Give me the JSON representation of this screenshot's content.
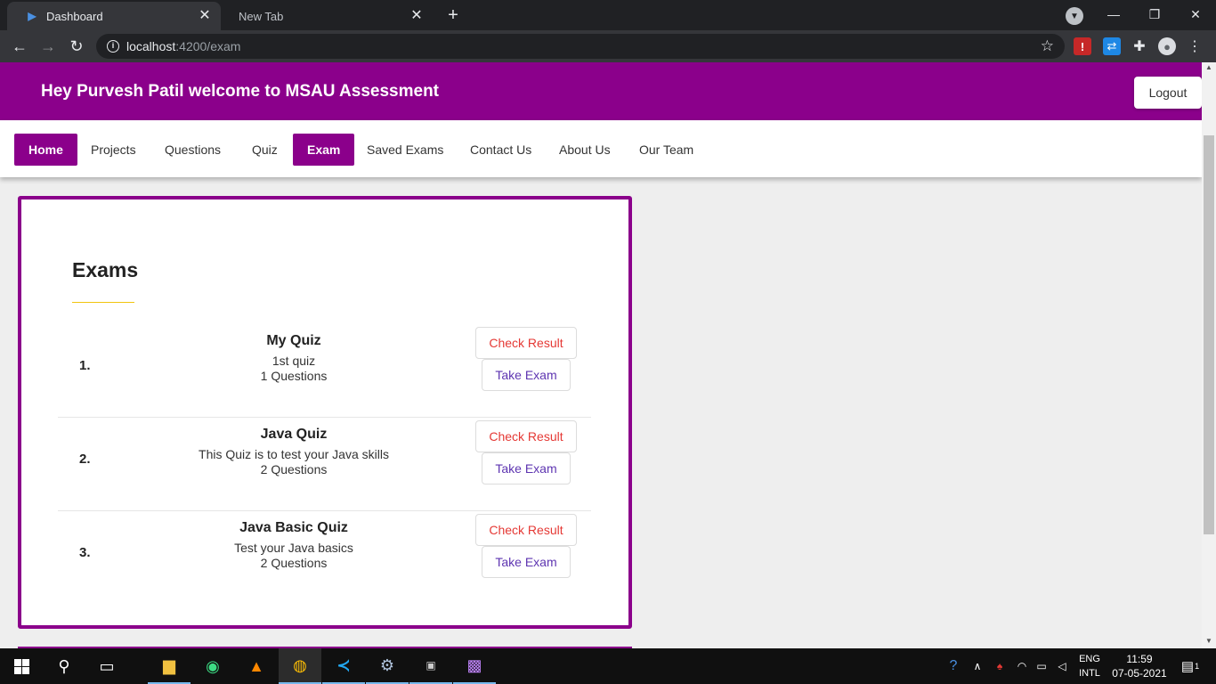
{
  "browser": {
    "tabs": [
      {
        "title": "Dashboard",
        "active": true
      },
      {
        "title": "New Tab",
        "active": false
      }
    ],
    "url_host": "localhost",
    "url_path": ":4200/exam",
    "close_glyph": "✕",
    "new_tab_glyph": "+",
    "icons": {
      "back": "←",
      "forward": "→",
      "reload": "↻",
      "star": "☆",
      "minimize": "—",
      "restore": "❐",
      "close": "✕"
    }
  },
  "app": {
    "brand_color": "#8b008b",
    "welcome": "Hey Purvesh Patil welcome to MSAU Assessment",
    "logout_label": "Logout",
    "nav": [
      {
        "label": "Home",
        "active": true
      },
      {
        "label": "Projects",
        "active": false
      },
      {
        "label": "Questions",
        "active": false
      },
      {
        "label": "Quiz",
        "active": false
      },
      {
        "label": "Exam",
        "active": true
      },
      {
        "label": "Saved Exams",
        "active": false
      },
      {
        "label": "Contact Us",
        "active": false
      },
      {
        "label": "About Us",
        "active": false
      },
      {
        "label": "Our Team",
        "active": false
      }
    ],
    "section_title": "Exams",
    "exams": [
      {
        "num": "1.",
        "name": "My Quiz",
        "desc": "1st quiz",
        "questions": "1 Questions",
        "check": "Check Result",
        "take": "Take Exam"
      },
      {
        "num": "2.",
        "name": "Java Quiz",
        "desc": "This Quiz is to test your Java skills",
        "questions": "2 Questions",
        "check": "Check Result",
        "take": "Take Exam"
      },
      {
        "num": "3.",
        "name": "Java Basic Quiz",
        "desc": "Test your Java basics",
        "questions": "2 Questions",
        "check": "Check Result",
        "take": "Take Exam"
      }
    ]
  },
  "taskbar": {
    "lang_top": "ENG",
    "lang_bottom": "INTL",
    "time": "11:59",
    "date": "07-05-2021",
    "notification_count": "1"
  }
}
